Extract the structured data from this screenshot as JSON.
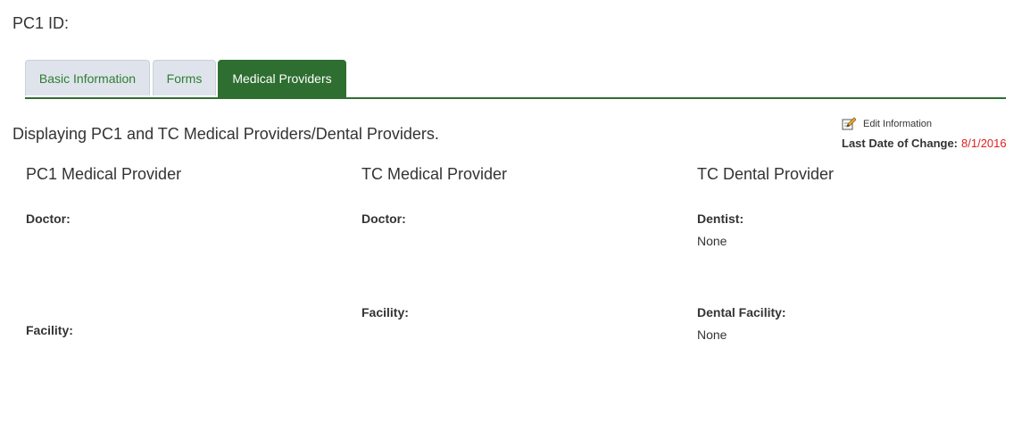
{
  "header": {
    "pc1_id_label": "PC1 ID:"
  },
  "tabs": [
    {
      "label": "Basic Information",
      "active": false
    },
    {
      "label": "Forms",
      "active": false
    },
    {
      "label": "Medical Providers",
      "active": true
    }
  ],
  "colors": {
    "accent_green": "#2e6e30",
    "tab_inactive_bg": "#dfe4ec",
    "date_red": "#e02020"
  },
  "main": {
    "description": "Displaying PC1 and TC Medical Providers/Dental Providers.",
    "edit_label": "Edit Information",
    "edit_icon": "pencil-edit-icon",
    "last_change_label": "Last Date of Change:",
    "last_change_value": "8/1/2016"
  },
  "columns": [
    {
      "title": "PC1 Medical Provider",
      "fields": [
        {
          "label": "Doctor:",
          "value": ""
        },
        {
          "label": "Facility:",
          "value": ""
        }
      ]
    },
    {
      "title": "TC Medical Provider",
      "fields": [
        {
          "label": "Doctor:",
          "value": ""
        },
        {
          "label": "Facility:",
          "value": ""
        }
      ]
    },
    {
      "title": "TC Dental Provider",
      "fields": [
        {
          "label": "Dentist:",
          "value": "None"
        },
        {
          "label": "Dental Facility:",
          "value": "None"
        }
      ]
    }
  ]
}
